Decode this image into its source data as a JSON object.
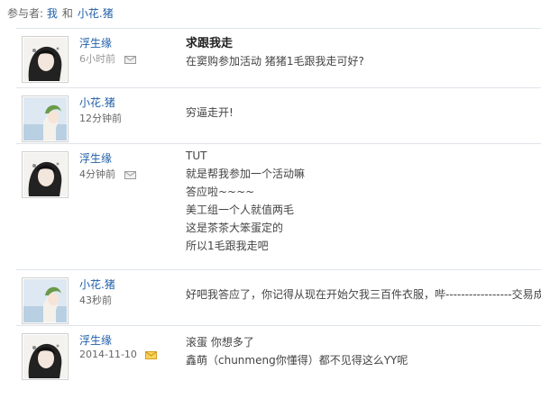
{
  "participants": {
    "label": "参与者:",
    "me": "我",
    "and": "和",
    "other": "小花.猪"
  },
  "messages": [
    {
      "author": "浮生缘",
      "time": "6小时前",
      "time_grey": true,
      "icon": "envelope-grey-icon",
      "subject": "求跟我走",
      "lines": [
        "在窦购参加活动 猪猪1毛跟我走可好?"
      ]
    },
    {
      "author": "小花.猪",
      "time": "12分钟前",
      "icon": "",
      "lines": [
        "穷逼走开!"
      ]
    },
    {
      "author": "浮生缘",
      "time": "4分钟前",
      "icon": "envelope-grey-icon",
      "lines": [
        "TUT",
        "就是帮我参加一个活动嘛",
        "答应啦~~~~",
        "美工组一个人就值两毛",
        "这是茶茶大笨蛋定的",
        "所以1毛跟我走吧"
      ]
    },
    {
      "author": "小花.猪",
      "time": "43秒前",
      "icon": "",
      "lines": [
        "好吧我答应了，你记得从现在开始欠我三百件衣服，哔-----------------交易成功"
      ]
    },
    {
      "author": "浮生缘",
      "time": "2014-11-10",
      "icon": "envelope-yellow-icon",
      "lines": [
        "滚蛋  你想多了",
        "鑫萌（chunmeng你懂得）都不见得这么YY呢"
      ]
    }
  ],
  "colors": {
    "link": "#1f5ea8",
    "divider": "#dfe4ea",
    "envelope_unread": "#e9b72d"
  }
}
